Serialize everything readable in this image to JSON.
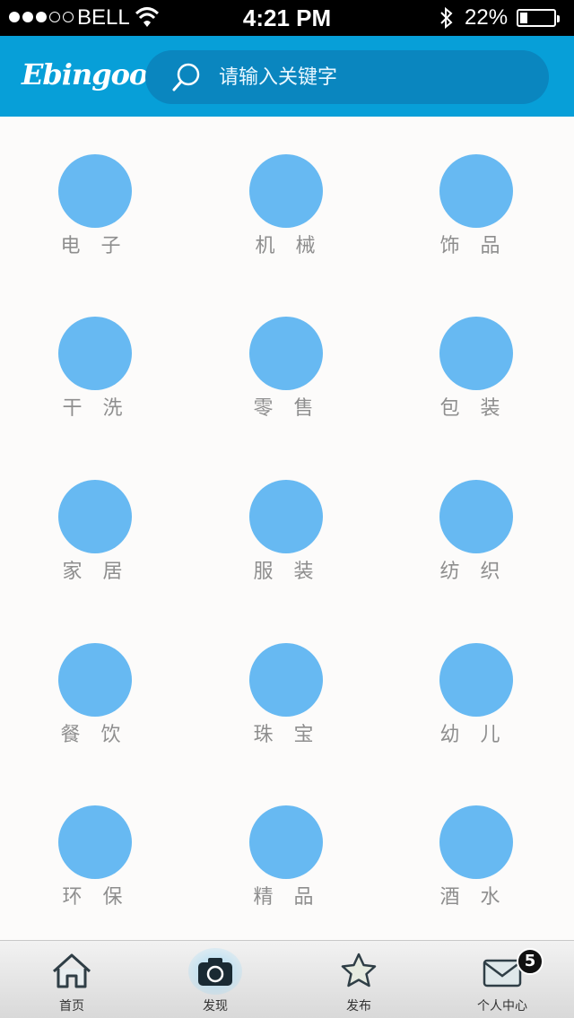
{
  "status_bar": {
    "carrier": "BELL",
    "time": "4:21 PM",
    "battery_text": "22%",
    "battery_level": 0.22,
    "signal_bars": 3
  },
  "header": {
    "logo": "Ebingoo",
    "search_placeholder": "请输入关键字"
  },
  "categories": [
    "电 子",
    "机 械",
    "饰 品",
    "干 洗",
    "零 售",
    "包 装",
    "家 居",
    "服 装",
    "纺 织",
    "餐 饮",
    "珠 宝",
    "幼 儿",
    "环 保",
    "精 品",
    "酒 水"
  ],
  "tabs": [
    {
      "label": "首页",
      "icon": "home-icon"
    },
    {
      "label": "发现",
      "icon": "camera-icon",
      "active": true
    },
    {
      "label": "发布",
      "icon": "star-icon"
    },
    {
      "label": "个人中心",
      "icon": "mail-icon",
      "badge": "5"
    }
  ],
  "colors": {
    "header": "#079fd8",
    "search_bg": "#0a86bf",
    "circle": "#67b9f2",
    "label": "#8e8e8e"
  }
}
